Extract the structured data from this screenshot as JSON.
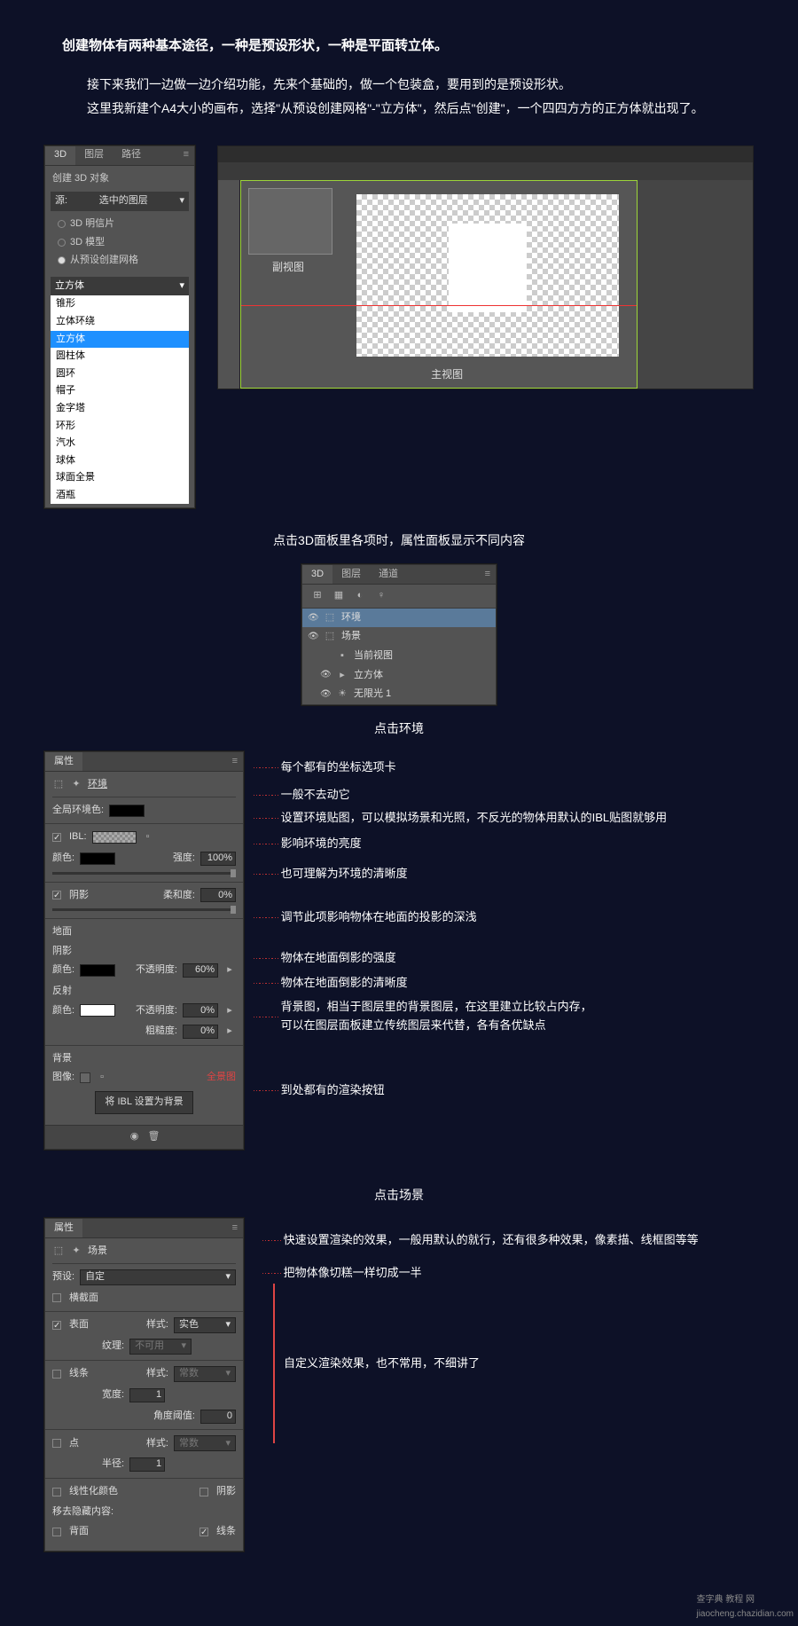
{
  "intro": {
    "title": "创建物体有两种基本途径，一种是预设形状，一种是平面转立体。",
    "p1": "接下来我们一边做一边介绍功能，先来个基础的，做一个包装盒，要用到的是预设形状。",
    "p2": "这里我新建个A4大小的画布，选择\"从预设创建网格\"-\"立方体\"，然后点\"创建\"，一个四四方方的正方体就出现了。"
  },
  "p3d_top": {
    "tabs": [
      "3D",
      "图层",
      "路径"
    ],
    "create_title": "创建 3D 对象",
    "source_lbl": "源:",
    "source_val": "选中的图层",
    "radios": [
      "3D 明信片",
      "3D 模型",
      "从预设创建网格"
    ],
    "dd_selected": "立方体",
    "options": [
      "锥形",
      "立体环绕",
      "立方体",
      "圆柱体",
      "圆环",
      "帽子",
      "金字塔",
      "环形",
      "汽水",
      "球体",
      "球面全景",
      "酒瓶"
    ]
  },
  "ps": {
    "thumb": "副视图",
    "main": "主视图"
  },
  "caption1": "点击3D面板里各项时，属性面板显示不同内容",
  "tree": {
    "tabs": [
      "3D",
      "图层",
      "通道"
    ],
    "items": [
      {
        "icon": "⬚",
        "label": "环境",
        "sel": true
      },
      {
        "icon": "⬚",
        "label": "场景"
      },
      {
        "icon": "▪",
        "label": "当前视图",
        "indent": 1
      },
      {
        "icon": "▸",
        "label": "立方体",
        "indent": 1
      },
      {
        "icon": "☀",
        "label": "无限光 1",
        "indent": 1
      }
    ]
  },
  "env": {
    "heading": "点击环境",
    "panel_title": "属性",
    "env_tab": "环境",
    "ann_coord": "每个都有的坐标选项卡",
    "global_lbl": "全局环境色:",
    "ann_global": "一般不去动它",
    "ibl_lbl": "IBL:",
    "ann_ibl": "设置环境贴图，可以模拟场景和光照，不反光的物体用默认的IBL贴图就够用",
    "color_lbl": "颜色:",
    "intensity_lbl": "强度:",
    "intensity_val": "100%",
    "ann_intensity": "影响环境的亮度",
    "shadow_lbl": "阴影",
    "soft_lbl": "柔和度:",
    "soft_val": "0%",
    "ann_soft": "也可理解为环境的清晰度",
    "ground_lbl": "地面",
    "ground_shadow": "阴影",
    "g_color": "颜色:",
    "g_opacity_lbl": "不透明度:",
    "g_opacity_val": "60%",
    "ann_g_opacity": "调节此项影响物体在地面的投影的深浅",
    "reflect_lbl": "反射",
    "r_color": "颜色:",
    "r_opacity_lbl": "不透明度:",
    "r_opacity_val": "0%",
    "ann_r_opacity": "物体在地面倒影的强度",
    "rough_lbl": "粗糙度:",
    "rough_val": "0%",
    "ann_rough": "物体在地面倒影的清晰度",
    "bg_lbl": "背景",
    "img_lbl": "图像:",
    "pano": "全景图",
    "ann_bg1": "背景图，相当于图层里的背景图层，在这里建立比较占内存，",
    "ann_bg2": "可以在图层面板建立传统图层来代替，各有各优缺点",
    "btn_ibl": "将 IBL 设置为背景",
    "ann_render": "到处都有的渲染按钮"
  },
  "scene": {
    "heading": "点击场景",
    "panel_title": "属性",
    "scene_tab": "场景",
    "preset_lbl": "预设:",
    "preset_val": "自定",
    "ann_preset": "快速设置渲染的效果，一般用默认的就行，还有很多种效果，像素描、线框图等等",
    "cross_lbl": "横截面",
    "ann_cross": "把物体像切糕一样切成一半",
    "surface_lbl": "表面",
    "style_lbl": "样式:",
    "style_val": "实色",
    "texture_lbl": "纹理:",
    "texture_val": "不可用",
    "lines_lbl": "线条",
    "l_style": "常数",
    "width_lbl": "宽度:",
    "width_val": "1",
    "angle_lbl": "角度阈值:",
    "angle_val": "0",
    "ann_custom": "自定义渲染效果，也不常用，不细讲了",
    "points_lbl": "点",
    "p_style": "常数",
    "radius_lbl": "半径:",
    "radius_val": "1",
    "linearize": "线性化颜色",
    "shadow_chk": "阴影",
    "remove_lbl": "移去隐藏内容:",
    "back_lbl": "背面",
    "lines_chk": "线条"
  },
  "watermark": {
    "t1": "查字典 教程 网",
    "t2": "jiaocheng.chazidian.com"
  }
}
